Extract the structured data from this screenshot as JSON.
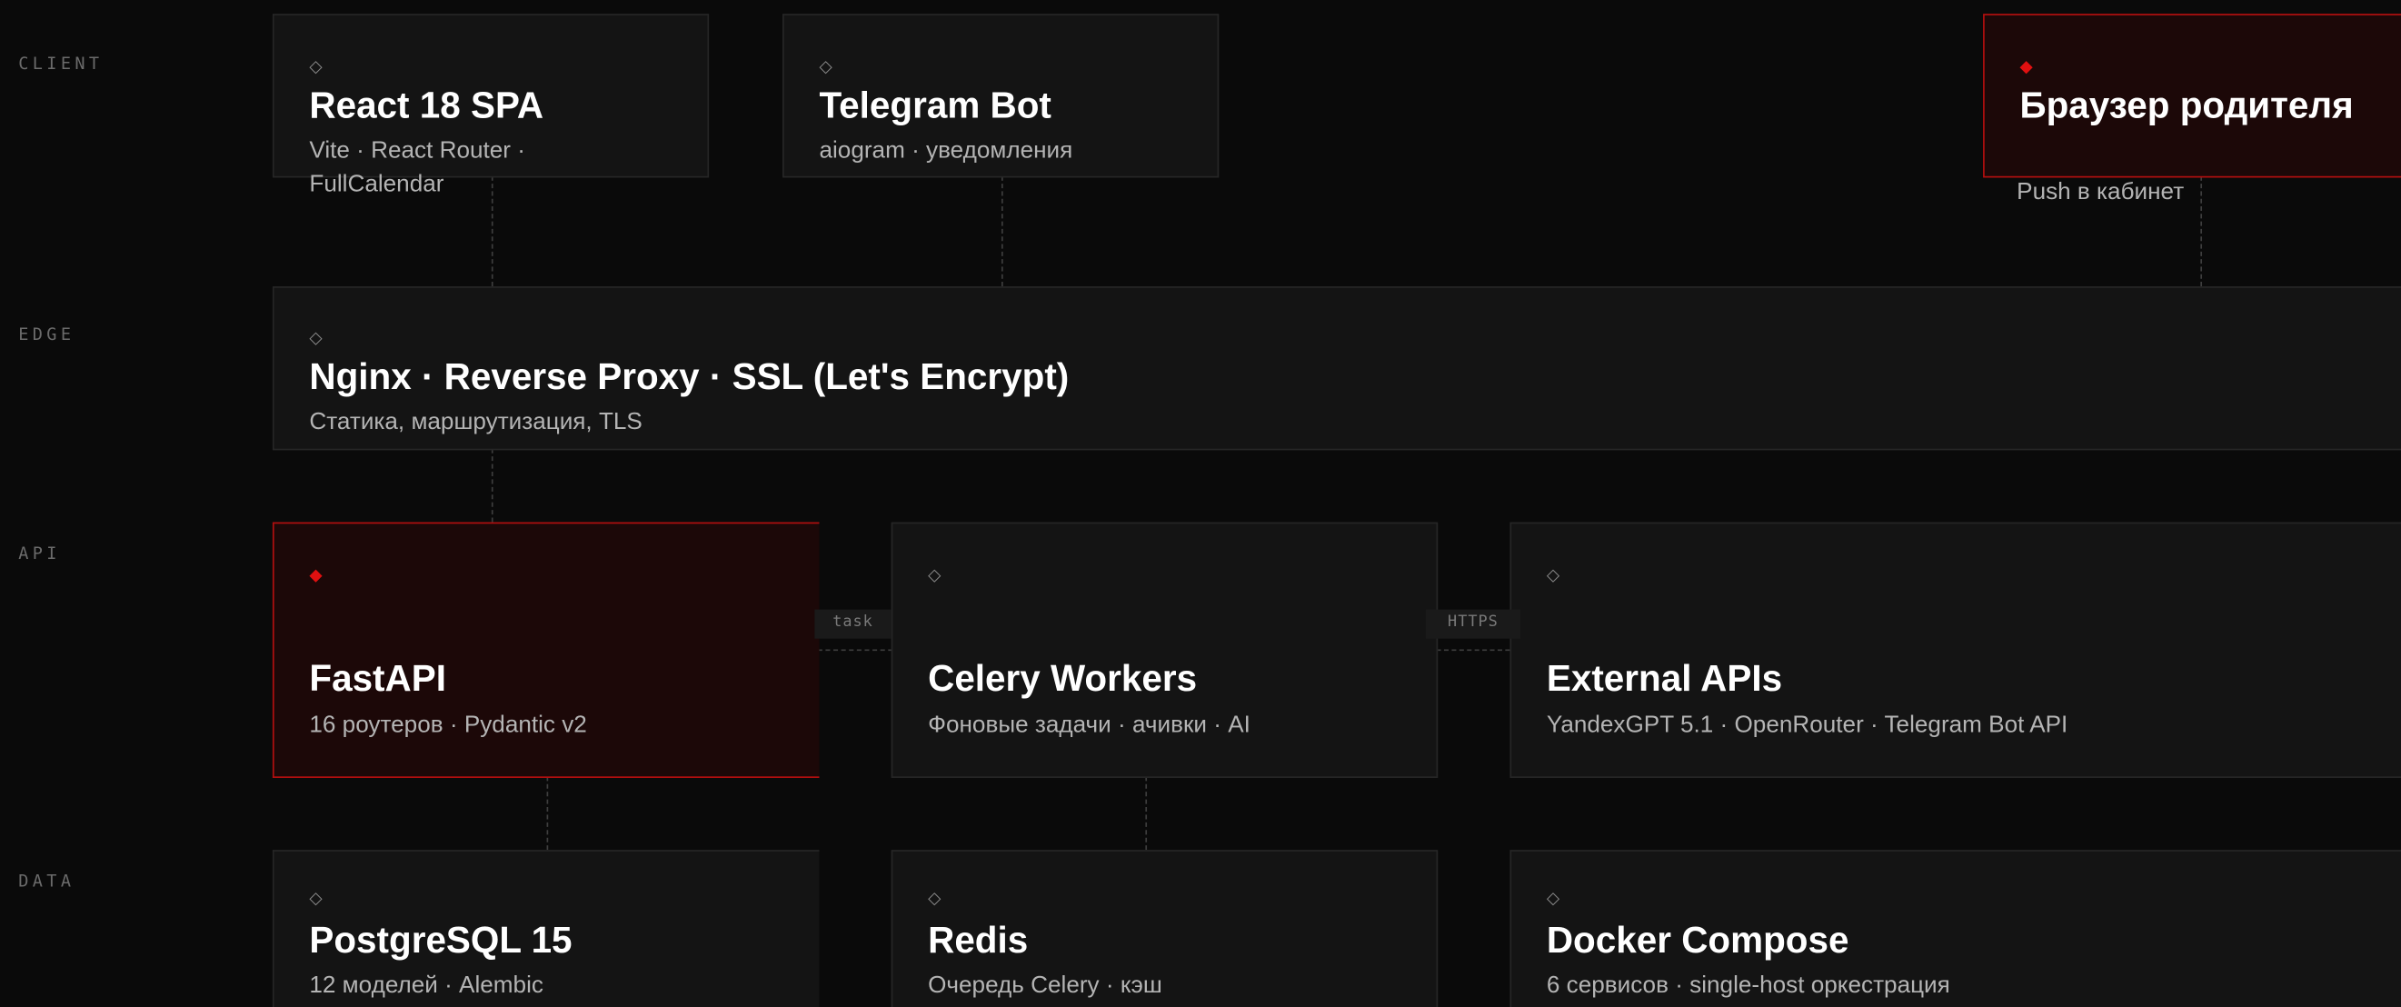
{
  "tiers": {
    "client": "CLIENT",
    "edge": "EDGE",
    "api": "API",
    "data": "DATA"
  },
  "nodes": {
    "react": {
      "icon": "diamond-outline-icon",
      "title": "React 18 SPA",
      "subtitle_line1": "Vite · React Router ·",
      "subtitle_line2": "FullCalendar"
    },
    "telegram_bot": {
      "icon": "diamond-outline-icon",
      "title": "Telegram Bot",
      "subtitle": "aiogram · уведомления"
    },
    "parent_browser": {
      "icon": "diamond-filled-icon",
      "title": "Браузер родителя",
      "subtitle": "Push в кабинет",
      "highlighted": true
    },
    "nginx": {
      "icon": "diamond-outline-icon",
      "title": "Nginx · Reverse Proxy · SSL (Let's Encrypt)",
      "subtitle": "Статика, маршрутизация, TLS"
    },
    "fastapi": {
      "icon": "diamond-filled-icon",
      "title": "FastAPI",
      "subtitle": "16 роутеров · Pydantic v2",
      "highlighted": true
    },
    "celery": {
      "icon": "diamond-outline-icon",
      "title": "Celery Workers",
      "subtitle": "Фоновые задачи · ачивки · AI"
    },
    "external_apis": {
      "icon": "diamond-outline-icon",
      "title": "External APIs",
      "subtitle": "YandexGPT 5.1 · OpenRouter · Telegram Bot API"
    },
    "postgres": {
      "icon": "diamond-outline-icon",
      "title": "PostgreSQL 15",
      "subtitle": "12 моделей · Alembic"
    },
    "redis": {
      "icon": "diamond-outline-icon",
      "title": "Redis",
      "subtitle": "Очередь Celery · кэш"
    },
    "docker": {
      "icon": "diamond-outline-icon",
      "title": "Docker Compose",
      "subtitle": "6 сервисов · single-host оркестрация"
    }
  },
  "edges": {
    "fastapi_celery": "task",
    "celery_external": "HTTPS"
  },
  "colors": {
    "background": "#0a0a0a",
    "box": "#141414",
    "box_border": "#262626",
    "accent": "#b30f0f",
    "accent_fill": "#1c0808",
    "accent_icon": "#e01010"
  }
}
